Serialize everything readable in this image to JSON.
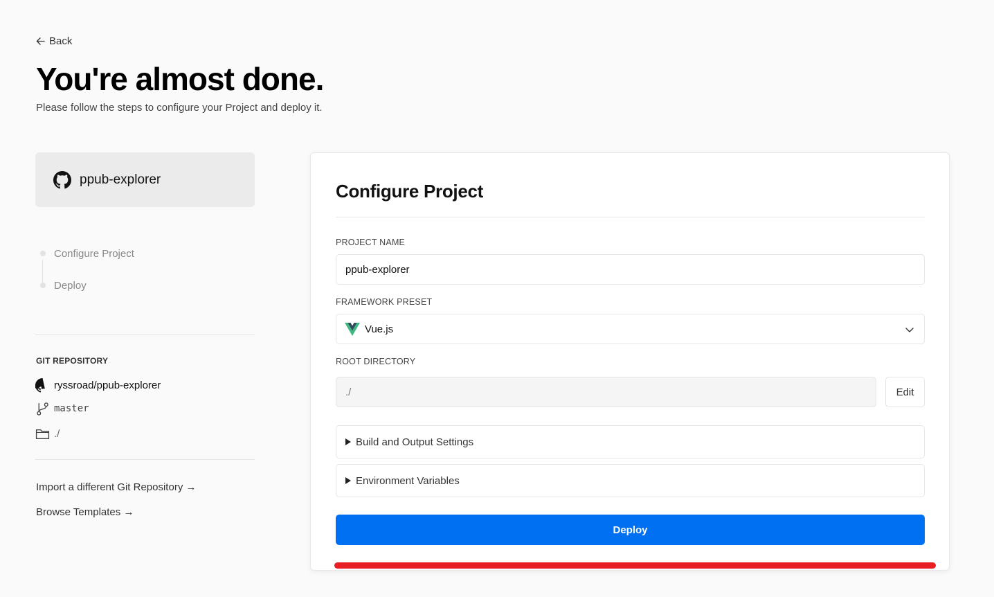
{
  "nav": {
    "back_label": "Back"
  },
  "header": {
    "title": "You're almost done.",
    "subtitle": "Please follow the steps to configure your Project and deploy it."
  },
  "repo_card": {
    "name": "ppub-explorer",
    "icon": "github-icon"
  },
  "steps": [
    {
      "label": "Configure Project"
    },
    {
      "label": "Deploy"
    }
  ],
  "git": {
    "heading": "GIT REPOSITORY",
    "repository": "ryssroad/ppub-explorer",
    "branch": "master",
    "directory": "./"
  },
  "links": {
    "import": "Import a different Git Repository →",
    "templates": "Browse Templates →"
  },
  "configure": {
    "title": "Configure Project",
    "project_name_label": "PROJECT NAME",
    "project_name_value": "ppub-explorer",
    "framework_label": "FRAMEWORK PRESET",
    "framework_value": "Vue.js",
    "root_label": "ROOT DIRECTORY",
    "root_value": "./",
    "edit_label": "Edit",
    "build_settings": "Build and Output Settings",
    "env_vars": "Environment Variables",
    "deploy_label": "Deploy"
  },
  "colors": {
    "accent": "#0070f3",
    "progress": "#e81e25",
    "vue_green": "#41b883",
    "vue_dark": "#35495e"
  }
}
